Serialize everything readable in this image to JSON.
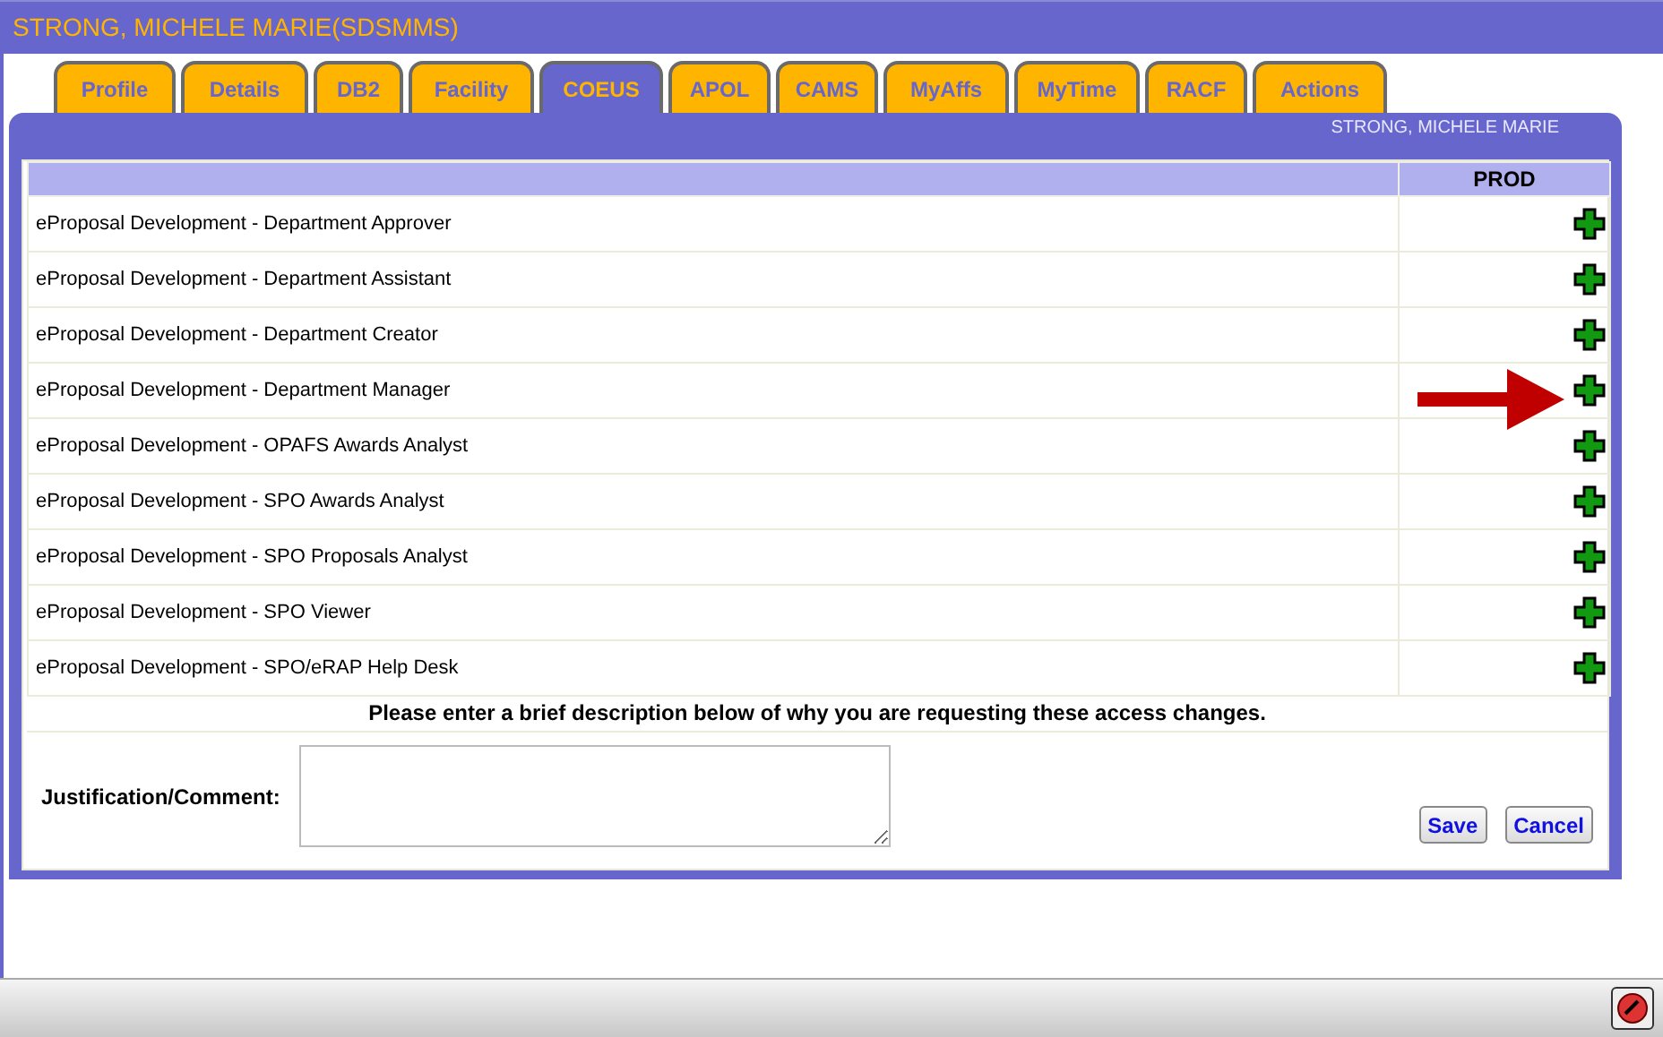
{
  "window": {
    "title": "STRONG, MICHELE MARIE(SDSMMS)"
  },
  "tabs": [
    {
      "label": "Profile",
      "selected": false
    },
    {
      "label": "Details",
      "selected": false
    },
    {
      "label": "DB2",
      "selected": false
    },
    {
      "label": "Facility",
      "selected": false
    },
    {
      "label": "COEUS",
      "selected": true
    },
    {
      "label": "APOL",
      "selected": false
    },
    {
      "label": "CAMS",
      "selected": false
    },
    {
      "label": "MyAffs",
      "selected": false
    },
    {
      "label": "MyTime",
      "selected": false
    },
    {
      "label": "RACF",
      "selected": false
    },
    {
      "label": "Actions",
      "selected": false
    }
  ],
  "panel": {
    "user_name": "STRONG, MICHELE MARIE"
  },
  "table": {
    "columns": [
      "PROD"
    ],
    "rows": [
      {
        "role": "eProposal Development - Department Approver",
        "marked": false
      },
      {
        "role": "eProposal Development - Department Assistant",
        "marked": false
      },
      {
        "role": "eProposal Development - Department Creator",
        "marked": false
      },
      {
        "role": "eProposal Development - Department Manager",
        "marked": true
      },
      {
        "role": "eProposal Development - OPAFS Awards Analyst",
        "marked": false
      },
      {
        "role": "eProposal Development - SPO Awards Analyst",
        "marked": false
      },
      {
        "role": "eProposal Development - SPO Proposals Analyst",
        "marked": false
      },
      {
        "role": "eProposal Development - SPO Viewer",
        "marked": false
      },
      {
        "role": "eProposal Development - SPO/eRAP Help Desk",
        "marked": false
      }
    ]
  },
  "instruction": "Please enter a brief description below of why you are requesting these access changes.",
  "comment": {
    "label": "Justification/Comment:"
  },
  "buttons": [
    "Save",
    "Cancel"
  ]
}
